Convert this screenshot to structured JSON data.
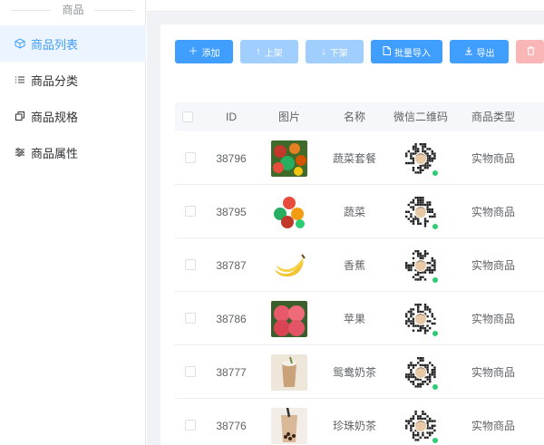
{
  "sidebar": {
    "group_title": "商品",
    "items": [
      {
        "label": "商品列表",
        "icon": "cube-icon",
        "active": true
      },
      {
        "label": "商品分类",
        "icon": "list-icon",
        "active": false
      },
      {
        "label": "商品规格",
        "icon": "copy-icon",
        "active": false
      },
      {
        "label": "商品属性",
        "icon": "sliders-icon",
        "active": false
      }
    ]
  },
  "toolbar": {
    "add_label": "添加",
    "on_shelf_label": "上架",
    "off_shelf_label": "下架",
    "import_label": "批量导入",
    "export_label": "导出"
  },
  "table": {
    "headers": [
      "ID",
      "图片",
      "名称",
      "微信二维码",
      "商品类型"
    ],
    "rows": [
      {
        "id": "38796",
        "name": "蔬菜套餐",
        "type": "实物商品",
        "image": "vegetable-basket"
      },
      {
        "id": "38795",
        "name": "蔬菜",
        "type": "实物商品",
        "image": "vegetables"
      },
      {
        "id": "38787",
        "name": "香蕉",
        "type": "实物商品",
        "image": "bananas"
      },
      {
        "id": "38786",
        "name": "苹果",
        "type": "实物商品",
        "image": "apples"
      },
      {
        "id": "38777",
        "name": "鸳鸯奶茶",
        "type": "实物商品",
        "image": "milk-tea"
      },
      {
        "id": "38776",
        "name": "珍珠奶茶",
        "type": "实物商品",
        "image": "bubble-tea"
      }
    ]
  },
  "colors": {
    "primary": "#409eff",
    "active_bg": "#ecf5ff",
    "danger_disabled": "#fab6b6"
  }
}
